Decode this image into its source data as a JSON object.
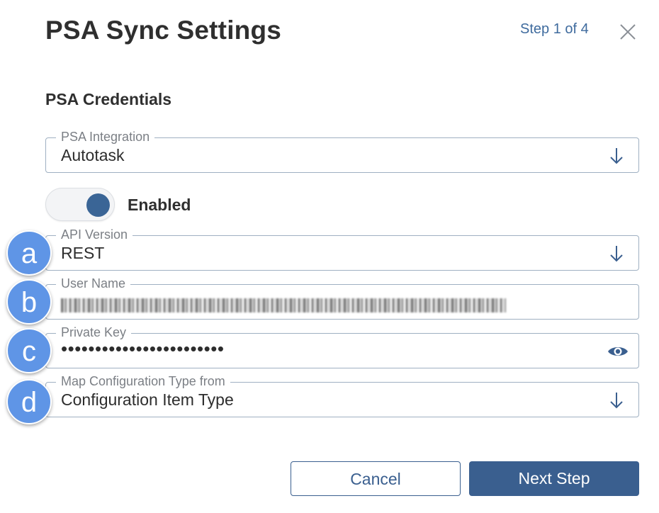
{
  "header": {
    "title": "PSA Sync Settings",
    "step": "Step 1 of 4"
  },
  "section_title": "PSA Credentials",
  "fields": {
    "psa_integration": {
      "label": "PSA Integration",
      "value": "Autotask"
    },
    "api_version": {
      "label": "API Version",
      "value": "REST"
    },
    "user_name": {
      "label": "User Name",
      "value": ""
    },
    "private_key": {
      "label": "Private Key",
      "value": "••••••••••••••••••••••••"
    },
    "map_config": {
      "label": "Map Configuration Type from",
      "value": "Configuration Item Type"
    }
  },
  "toggle": {
    "label": "Enabled",
    "state": "on"
  },
  "annotations": [
    "a",
    "b",
    "c",
    "d"
  ],
  "buttons": {
    "cancel": "Cancel",
    "next": "Next Step"
  },
  "colors": {
    "accent": "#3a5f8f",
    "link": "#3f6b9e",
    "badge": "#5f95e6"
  }
}
